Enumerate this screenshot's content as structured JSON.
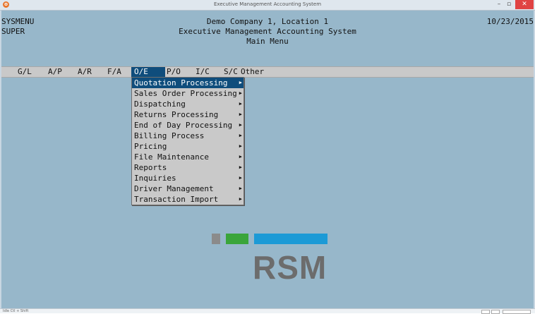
{
  "window": {
    "title": "Executive Management Accounting System",
    "app_icon": "o"
  },
  "header": {
    "program": "SYSMENU",
    "user": "SUPER",
    "company": "Demo Company 1, Location 1",
    "system": "Executive Management Accounting System",
    "menu_title": "Main Menu",
    "date": "10/23/2015"
  },
  "menubar": [
    "G/L",
    "A/P",
    "A/R",
    "F/A",
    "O/E",
    "P/O",
    "I/C",
    "S/C",
    "Other"
  ],
  "active_menu": "O/E",
  "dropdown": [
    "Quotation Processing",
    "Sales Order Processing",
    "Dispatching",
    "Returns Processing",
    "End of Day Processing",
    "Billing Process",
    "Pricing",
    "File Maintenance",
    "Reports",
    "Inquiries",
    "Driver Management",
    "Transaction Import"
  ],
  "logo": {
    "wordmark": "RSM",
    "colors": [
      "#8b8b8b",
      "#3aa53a",
      "#1c9ad6"
    ]
  },
  "statusbar": {
    "text": "Idle Ctl + Shift"
  },
  "colors": {
    "background": "#97b7ca",
    "menubar": "#c9c9c9",
    "highlight": "#0f4d7c"
  }
}
